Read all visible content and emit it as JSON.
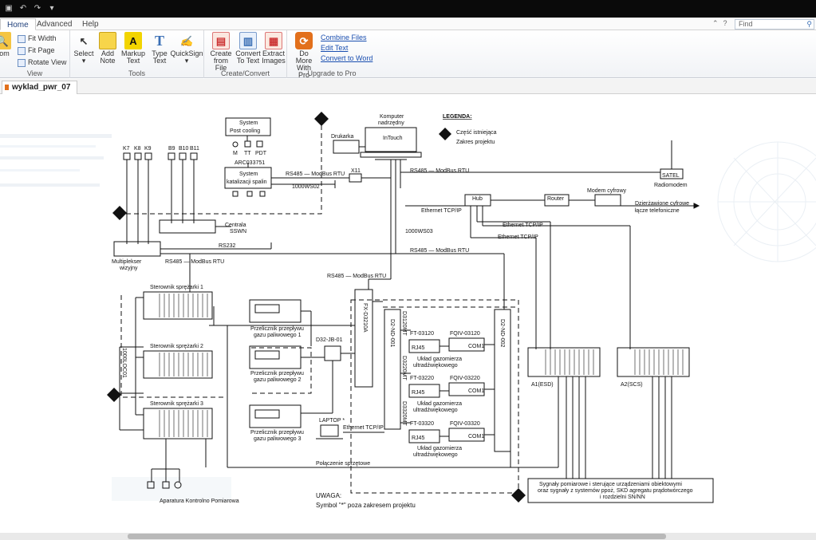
{
  "app": {
    "tabs": [
      "Home",
      "Advanced",
      "Help"
    ],
    "find_placeholder": "Find",
    "document_tab": "wyklad_pwr_07"
  },
  "ribbon": {
    "view": {
      "label": "View",
      "zoom": "oom",
      "fit_width": "Fit Width",
      "fit_page": "Fit Page",
      "rotate_view": "Rotate View"
    },
    "tools": {
      "label": "Tools",
      "select": "Select",
      "add_note_1": "Add",
      "add_note_2": "Note",
      "markup_1": "Markup",
      "markup_2": "Text",
      "type_1": "Type",
      "type_2": "Text",
      "quicksign": "QuickSign"
    },
    "create": {
      "label": "Create/Convert",
      "create_1": "Create",
      "create_2": "from File",
      "convert_1": "Convert",
      "convert_2": "To Text",
      "extract_1": "Extract",
      "extract_2": "Images"
    },
    "upgrade": {
      "label": "Upgrade to Pro",
      "domore_1": "Do More",
      "domore_2": "With Pro",
      "combine": "Combine Files",
      "edit": "Edit Text",
      "convert_word": "Convert to Word"
    }
  },
  "diagram": {
    "legend_title": "LEGENDA:",
    "legend_existing": "Część istniejąca",
    "legend_scope": "Zakres projektu",
    "computer_1": "Komputer",
    "computer_2": "nadrzędny",
    "intouch": "InTouch",
    "printer": "Drukarka",
    "post_cooling_1": "System",
    "post_cooling_2": "Post cooling",
    "pc_m": "M",
    "pc_tt": "TT",
    "pc_pdt": "PDT",
    "arc": "ARC033751",
    "catalysis_1": "System",
    "catalysis_2": "katalizacji spalin",
    "rs485_modbus": "RS485 — ModBus RTU",
    "x11": "X11",
    "ws02": "1000WS02",
    "k7": "K7",
    "k8": "K8",
    "k9": "K9",
    "b9": "B9",
    "b10": "B10",
    "b11": "B11",
    "centrala_1": "Centrala",
    "centrala_2": "SSWN",
    "rs232": "RS232",
    "mux_1": "Multiplekser",
    "mux_2": "wizyjny",
    "rs485_mux": "RS485 — ModBus RTU",
    "satel": "SATEL",
    "radiomodem": "Radiomodem",
    "rs485_top": "RS485 — ModBus RTU",
    "hub": "Hub",
    "router": "Router",
    "modem": "Modem cyfrowy",
    "leased_1": "Dzierżawione cyfrowe",
    "leased_2": "łącze telefoniczne",
    "eth1": "Ethernet TCP/IP",
    "eth2": "Ethernet TCP/IP",
    "eth3": "Ethernet TCP/IP",
    "ws03": "1000WS03",
    "rs485_mid": "RS485 — ModBus RTU",
    "rs485_fx": "RS485 — ModBus RTU",
    "fx": "FX-D3210A",
    "st1": "Sterownik sprężarki 1",
    "st2": "Sterownik sprężarki 2",
    "st3": "Sterownik sprężarki 3",
    "loc": "1000LOC01",
    "flow1_1": "Przelicznik przepływu",
    "flow1_2": "gazu paliwowego 1",
    "flow2_1": "Przelicznik przepływu",
    "flow2_2": "gazu paliwowego 2",
    "flow3_1": "Przelicznik przepływu",
    "flow3_2": "gazu paliwowego 3",
    "jb": "D32-JB-01",
    "nd001": "D2-ND-001",
    "nd002": "D2-ND-002",
    "d3120": "D3120MT",
    "d3220": "D3220MT",
    "d3320": "D3320MT",
    "ft1": "FT-03120",
    "fqiv1": "FQIV-03120",
    "ft2": "FT-03220",
    "fqiv2": "FQIV-03220",
    "ft3": "FT-03320",
    "fqiv3": "FQIV-03320",
    "rj45": "RJ45",
    "com1": "COM1",
    "uklad_1": "Układ gazomierza",
    "uklad_2": "ultradźwiękowego",
    "laptop": "LAPTOP *",
    "eth_laptop": "Ethernet TCP/IP",
    "hw_link": "Połączenie sprzętowe",
    "a1": "A1(ESD)",
    "a2": "A2(SCS)",
    "signals_1": "Sygnały pomiarowe i sterujące urządzeniami obiektowymi",
    "signals_2": "oraz sygnały z systemów ppoż, SKD agregatu prądotwórczego",
    "signals_3": "i rozdzielni SN/NN",
    "aparatura": "Aparatura Kontrolno Pomiarowa",
    "note_1": "UWAGA:",
    "note_2": "Symbol \"*\" poza zakresem projektu"
  }
}
